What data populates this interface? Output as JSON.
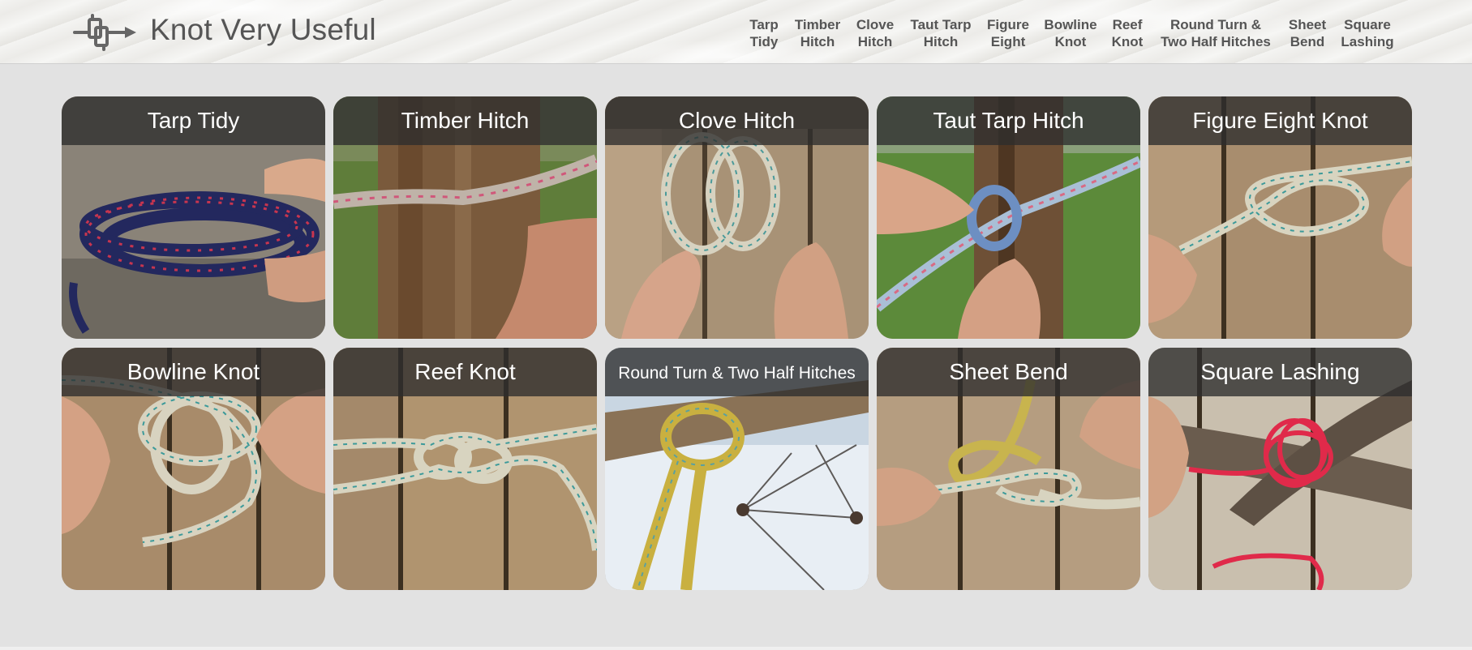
{
  "site": {
    "title": "Knot Very Useful",
    "logo_icon": "knot-logo-icon"
  },
  "nav": {
    "items": [
      {
        "line1": "Tarp",
        "line2": "Tidy"
      },
      {
        "line1": "Timber",
        "line2": "Hitch"
      },
      {
        "line1": "Clove",
        "line2": "Hitch"
      },
      {
        "line1": "Taut Tarp",
        "line2": "Hitch"
      },
      {
        "line1": "Figure",
        "line2": "Eight"
      },
      {
        "line1": "Bowline",
        "line2": "Knot"
      },
      {
        "line1": "Reef",
        "line2": "Knot"
      },
      {
        "line1": "Round Turn &",
        "line2": "Two Half Hitches"
      },
      {
        "line1": "Sheet",
        "line2": "Bend"
      },
      {
        "line1": "Square",
        "line2": "Lashing"
      }
    ]
  },
  "tiles": [
    {
      "title": "Tarp Tidy"
    },
    {
      "title": "Timber Hitch"
    },
    {
      "title": "Clove Hitch"
    },
    {
      "title": "Taut Tarp Hitch"
    },
    {
      "title": "Figure Eight Knot"
    },
    {
      "title": "Bowline Knot"
    },
    {
      "title": "Reef Knot"
    },
    {
      "title": "Round Turn & Two Half Hitches"
    },
    {
      "title": "Sheet Bend"
    },
    {
      "title": "Square Lashing"
    }
  ],
  "colors": {
    "page_bg": "#e2e2e2",
    "caption_bg": "#2d2d2d",
    "nav_text": "#555555",
    "title_text": "#555555"
  }
}
